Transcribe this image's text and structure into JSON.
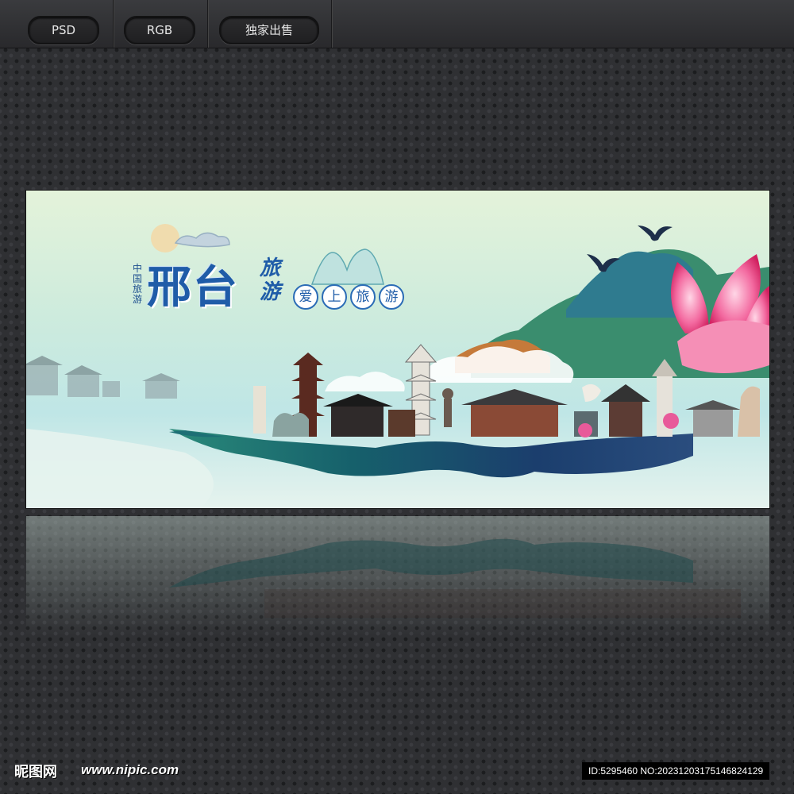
{
  "toolbar": {
    "tabs": [
      {
        "label": "PSD"
      },
      {
        "label": "RGB"
      },
      {
        "label": "独家出售"
      }
    ]
  },
  "banner": {
    "title": "邢台",
    "small_vertical": "中国旅游",
    "side_word": "旅游",
    "slogan": [
      "爱",
      "上",
      "旅",
      "游"
    ]
  },
  "footer": {
    "logo_text": "昵图网",
    "site_url": "www.nipic.com",
    "id_text": "ID:5295460 NO:20231203175146824129"
  },
  "colors": {
    "title_blue": "#1f5ca8",
    "page_bg": "#2f3033",
    "ink_teal": "#1d6f75",
    "ink_navy": "#1b3e6d",
    "flower_pink": "#e23c78"
  }
}
